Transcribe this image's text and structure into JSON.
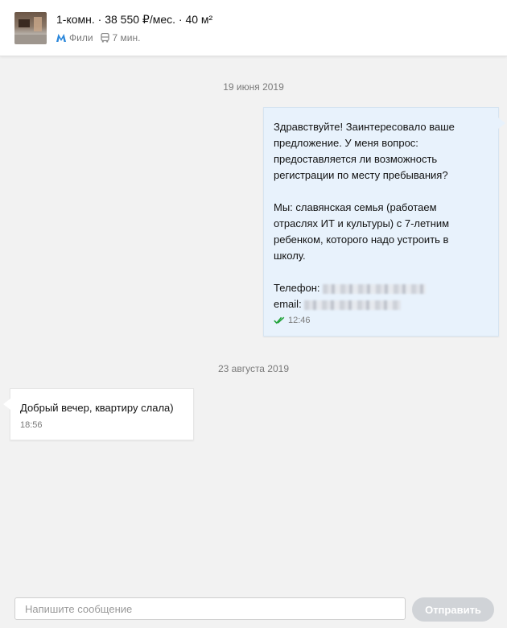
{
  "header": {
    "title": "1-комн. · 38 550 ₽/мес. · 40 м²",
    "metro_station": "Фили",
    "transport_time": "7 мин.",
    "metro_icon": "metro-icon",
    "transport_icon": "bus-icon",
    "accent_color": "#2b87db"
  },
  "messages": [
    {
      "date": "19 июня 2019",
      "direction": "outgoing",
      "text": "Здравствуйте! Заинтересовало ваше\nпредложение. У меня вопрос:\nпредоставляется ли возможность\nрегистрации по месту пребывания?\n\nМы: славянская семья (работаем\nотраслях ИТ и культуры) с 7-летним\nребенком, которого надо устроить в\nшколу.",
      "phone_label": "Телефон:",
      "email_label": "email:",
      "time": "12:46",
      "status": "read",
      "status_icon": "double-check-icon",
      "status_color": "#22a33a"
    },
    {
      "date": "23 августа 2019",
      "direction": "incoming",
      "text": "Добрый вечер, квартиру слала)",
      "time": "18:56"
    }
  ],
  "composer": {
    "placeholder": "Напишите сообщение",
    "send_label": "Отправить"
  }
}
